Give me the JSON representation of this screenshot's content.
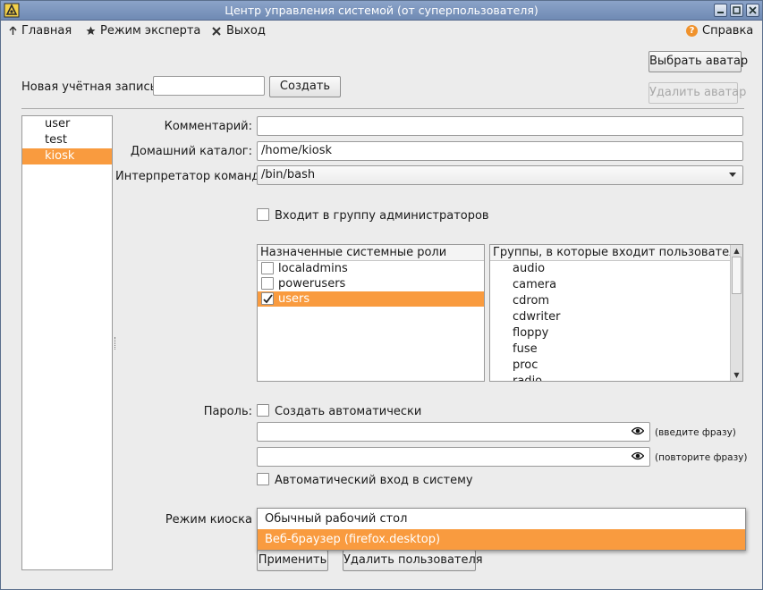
{
  "window": {
    "title": "Центр управления системой (от суперпользователя)"
  },
  "menu": {
    "home": "Главная",
    "expert": "Режим эксперта",
    "exit": "Выход",
    "help": "Справка"
  },
  "avatar": {
    "choose": "Выбрать аватар",
    "delete": "Удалить аватар"
  },
  "new_account": {
    "label": "Новая учётная запись:",
    "value": "",
    "create": "Создать"
  },
  "users": [
    {
      "name": "user"
    },
    {
      "name": "test"
    },
    {
      "name": "kiosk",
      "selected": true
    }
  ],
  "form": {
    "comment_label": "Комментарий:",
    "comment_value": "",
    "home_label": "Домашний каталог:",
    "home_value": "/home/kiosk",
    "shell_label": "Интерпретатор команд:",
    "shell_value": "/bin/bash",
    "admin_group": "Входит в группу администраторов"
  },
  "roles": {
    "header": "Назначенные системные роли",
    "items": [
      {
        "name": "localadmins",
        "checked": false
      },
      {
        "name": "powerusers",
        "checked": false
      },
      {
        "name": "users",
        "checked": true
      }
    ]
  },
  "groups": {
    "header": "Группы, в которые входит пользователь",
    "items": [
      "audio",
      "camera",
      "cdrom",
      "cdwriter",
      "floppy",
      "fuse",
      "proc",
      "radio"
    ]
  },
  "password": {
    "label": "Пароль:",
    "auto": "Создать автоматически",
    "enter_hint": "(введите фразу)",
    "repeat_hint": "(повторите фразу)",
    "autologin": "Автоматический вход в систему"
  },
  "kiosk": {
    "label": "Режим киоска",
    "options": [
      {
        "label": "Обычный рабочий стол",
        "selected": false
      },
      {
        "label": "Веб-браузер (firefox.desktop)",
        "selected": true
      }
    ]
  },
  "actions": {
    "apply": "Применить",
    "delete_user": "Удалить пользователя"
  },
  "colors": {
    "accent": "#f99b3f",
    "titlebar": "#7d97c0",
    "help_icon": "#f0922c"
  }
}
